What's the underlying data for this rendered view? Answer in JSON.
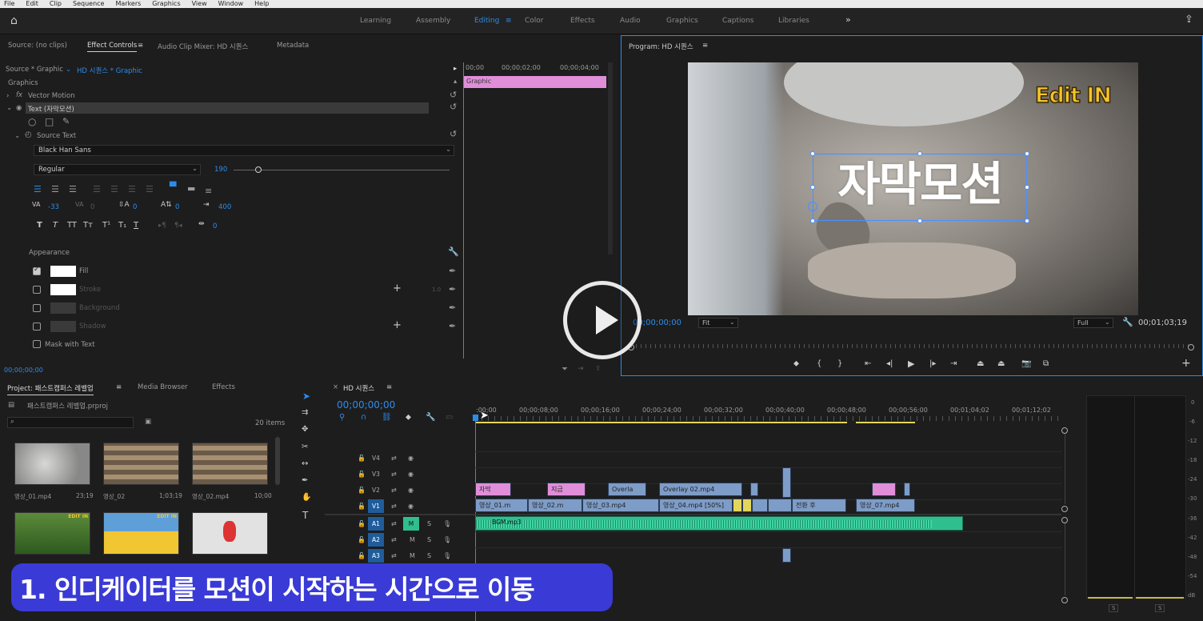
{
  "menu": [
    "File",
    "Edit",
    "Clip",
    "Sequence",
    "Markers",
    "Graphics",
    "View",
    "Window",
    "Help"
  ],
  "workspaces": [
    "Learning",
    "Assembly",
    "Editing",
    "Color",
    "Effects",
    "Audio",
    "Graphics",
    "Captions",
    "Libraries"
  ],
  "workspace_active": "Editing",
  "more_glyph": "»",
  "source_tabs": [
    "Source: (no clips)",
    "Effect Controls",
    "Audio Clip Mixer: HD 시퀀스",
    "Metadata"
  ],
  "effect_controls": {
    "source_label": "Source * Graphic",
    "seq_label": "HD 시퀀스 * Graphic",
    "graphics_header": "Graphics",
    "vector_motion": "Vector Motion",
    "text_layer": "Text (자막모션)",
    "source_text": "Source Text",
    "font": "Black Han Sans",
    "style": "Regular",
    "size": "190",
    "kerning": "-33",
    "tracking0": "0",
    "leading": "0",
    "baseline": "0",
    "tracking": "400",
    "tsume": "0",
    "appearance": "Appearance",
    "fill": "Fill",
    "stroke": "Stroke",
    "stroke_width": "1.0",
    "background": "Background",
    "shadow": "Shadow",
    "mask": "Mask with Text",
    "timecode": "00;00;00;00",
    "ruler": [
      "00;00",
      "00;00;02;00",
      "00;00;04;00"
    ],
    "clip_label": "Graphic"
  },
  "program": {
    "title": "Program: HD 시퀀스",
    "edit_in": "Edit IN",
    "caption": "자막모션",
    "timecode": "00;00;00;00",
    "fit": "Fit",
    "quality": "Full",
    "duration": "00;01;03;19"
  },
  "project": {
    "tabs": [
      "Project: 패스트캠퍼스 레벨업",
      "Media Browser",
      "Effects"
    ],
    "file": "패스트캠퍼스 레벨업.prproj",
    "count": "20 items",
    "items": [
      {
        "name": "영상_01.mp4",
        "dur": "23;19"
      },
      {
        "name": "영상_02",
        "dur": "1;03;19"
      },
      {
        "name": "영상_02.mp4",
        "dur": "10;00"
      },
      {
        "name": "",
        "dur": ""
      },
      {
        "name": "",
        "dur": ""
      },
      {
        "name": "",
        "dur": ""
      }
    ],
    "badge": "EDIT IN"
  },
  "timeline": {
    "title": "HD 시퀀스",
    "timecode": "00;00;00;00",
    "ruler": [
      ":00;00",
      "00;00;08;00",
      "00;00;16;00",
      "00;00;24;00",
      "00;00;32;00",
      "00;00;40;00",
      "00;00;48;00",
      "00;00;56;00",
      "00;01;04;02",
      "00;01;12;02"
    ],
    "tracks": [
      "V4",
      "V3",
      "V2",
      "V1",
      "A1",
      "A2",
      "A3"
    ],
    "clips_v2": [
      "자막",
      "지금",
      "Overla",
      "Overlay 02.mp4"
    ],
    "clips_v1": [
      "영상_01.m",
      "영상_02.m",
      "영상_03.mp4",
      "영상_04.mp4 [50%]",
      "전환 후",
      "영상_07.mp4"
    ],
    "clip_a1": "BGM.mp3",
    "m_label": "M",
    "s_label": "S"
  },
  "meter_ticks": [
    "0",
    "-6",
    "-12",
    "-18",
    "-24",
    "-30",
    "-36",
    "-42",
    "-48",
    "-54",
    "dB"
  ],
  "meter_solo": [
    "S",
    "S"
  ],
  "overlay_caption": "1. 인디케이터를 모션이 시작하는 시간으로 이동",
  "colors": {
    "accent": "#2d8ceb",
    "pink": "#e08ed9",
    "video": "#7d9cc7",
    "audio": "#2fbf8f",
    "caption_bg": "#3a3ad6"
  }
}
